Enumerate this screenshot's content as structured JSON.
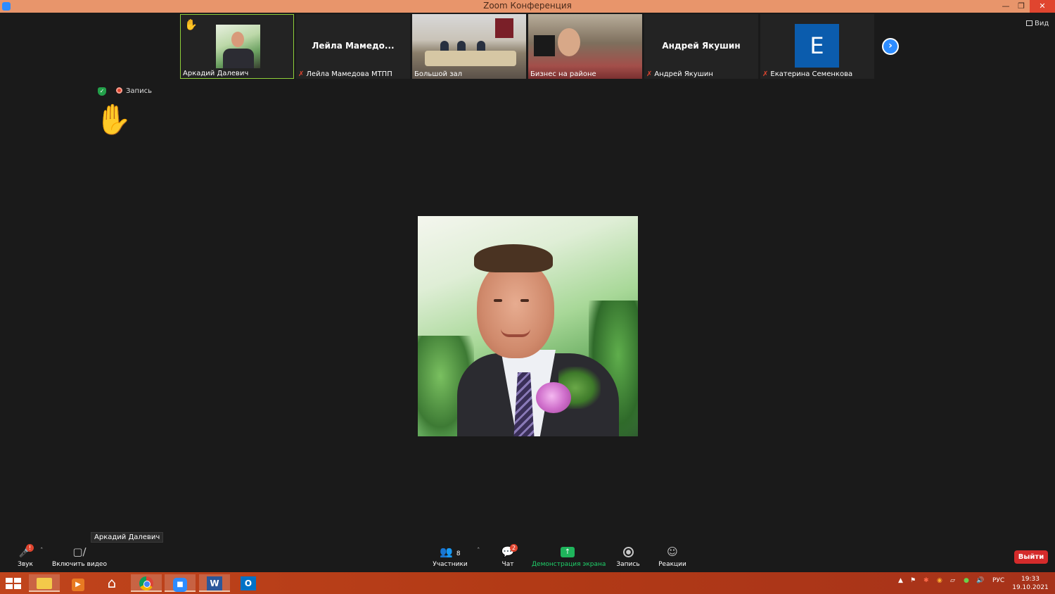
{
  "window": {
    "title": "Zoom Конференция"
  },
  "thumbnails": [
    {
      "label": "Аркадий Далевич",
      "type": "photo",
      "hand_raised": true,
      "muted": false,
      "active": true
    },
    {
      "label": "Лейла Мамедова МТПП",
      "display_name": "Лейла  Мамедо...",
      "type": "name",
      "muted": true
    },
    {
      "label": "Большой зал",
      "type": "video-room",
      "muted": false
    },
    {
      "label": "Бизнес на районе",
      "type": "video-person",
      "muted": false
    },
    {
      "label": "Андрей Якушин",
      "display_name": "Андрей Якушин",
      "type": "name",
      "muted": true
    },
    {
      "label": "Екатерина Семенкова",
      "avatar_letter": "E",
      "type": "letter",
      "muted": true
    }
  ],
  "view_button": {
    "label": "Вид",
    "icon": "grid-icon"
  },
  "status": {
    "recording_label": "Запись",
    "encryption_icon": "shield-icon"
  },
  "speaker": {
    "name_tag": "Аркадий Далевич",
    "hand_icon": "raised-hand-icon"
  },
  "toolbar": {
    "audio": {
      "label": "Звук",
      "icon": "microphone-icon"
    },
    "video": {
      "label": "Включить видео",
      "icon": "video-off-icon"
    },
    "participants": {
      "label": "Участники",
      "count": "8",
      "icon": "participants-icon"
    },
    "chat": {
      "label": "Чат",
      "badge": "2",
      "icon": "chat-icon"
    },
    "share": {
      "label": "Демонстрация экрана",
      "icon": "share-screen-icon"
    },
    "record": {
      "label": "Запись",
      "icon": "record-icon"
    },
    "reactions": {
      "label": "Реакции",
      "icon": "reactions-icon"
    },
    "leave": {
      "label": "Выйти"
    }
  },
  "taskbar": {
    "language": "РУС",
    "time": "19:33",
    "date": "19.10.2021"
  },
  "colors": {
    "accent": "#2d8cff",
    "share_green": "#1fb55c",
    "leave_red": "#d42b2b",
    "titlebar": "#e8956b",
    "taskbar": "#b23a16"
  }
}
